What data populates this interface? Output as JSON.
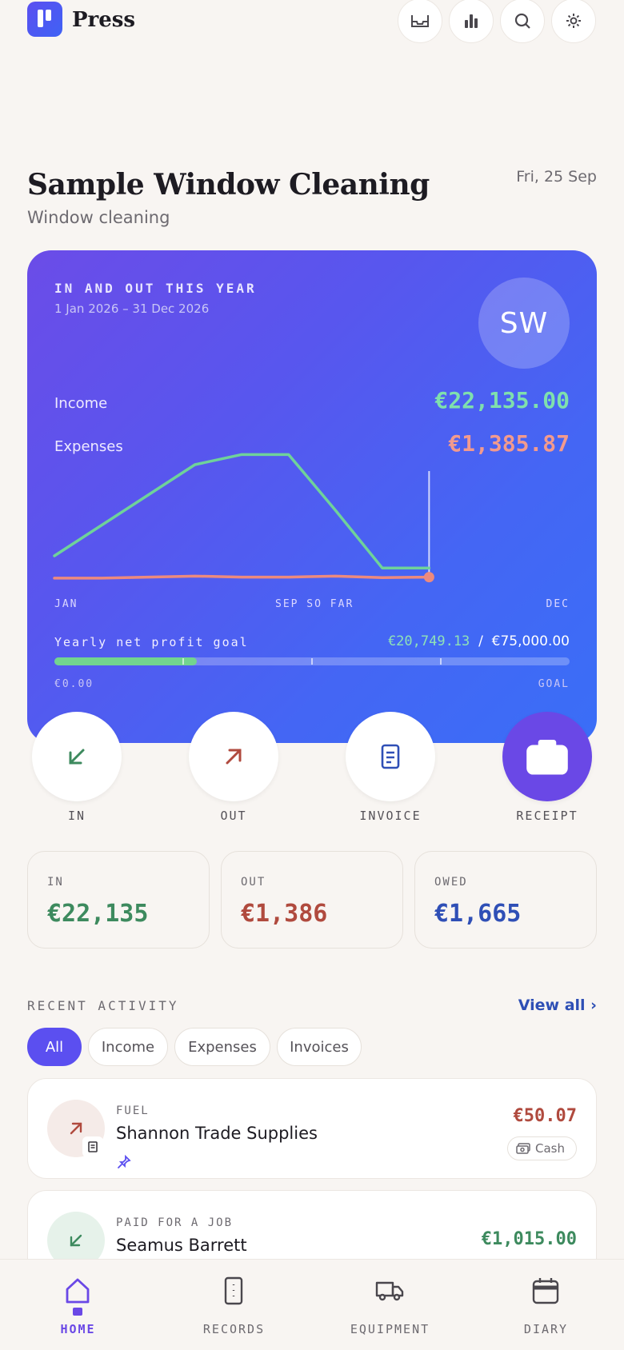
{
  "app": {
    "brand": "Press"
  },
  "header": {
    "icons": [
      "inbox-icon",
      "bar-chart-icon",
      "search-icon",
      "settings-icon"
    ]
  },
  "business": {
    "name": "Sample Window Cleaning",
    "trade": "Window cleaning",
    "date": "Fri, 25 Sep",
    "initials": "SW"
  },
  "summary": {
    "label": "IN AND OUT THIS YEAR",
    "range": "1 Jan 2026 – 31 Dec 2026",
    "income_label": "Income",
    "income_value": "€22,135.00",
    "expenses_label": "Expenses",
    "expenses_value": "€1,385.87",
    "axis_start": "JAN",
    "axis_mid": "SEP SO FAR",
    "axis_end": "DEC",
    "goal_label": "Yearly net profit goal",
    "goal_current": "€20,749.13",
    "goal_sep": "/",
    "goal_target": "€75,000.00",
    "goal_progress": 0.277,
    "goal_start": "€0.00",
    "goal_end": "GOAL"
  },
  "chart_data": {
    "type": "line",
    "x": [
      1,
      2,
      3,
      4,
      5,
      6,
      7,
      8,
      9
    ],
    "series": [
      {
        "values": [
          3000,
          6000,
          9000,
          12000,
          13000,
          13000,
          7500,
          1800,
          1800
        ],
        "color": "#6fd29a"
      },
      {
        "values": [
          800,
          800,
          900,
          1000,
          900,
          900,
          1000,
          850,
          900
        ],
        "color": "#ec8a7e"
      }
    ],
    "xlim": [
      1,
      12
    ],
    "ylim": [
      0,
      15000
    ],
    "current_month": 9,
    "grid": false
  },
  "actions": [
    {
      "label": "IN",
      "icon": "arrow-down-left-icon"
    },
    {
      "label": "OUT",
      "icon": "arrow-up-right-icon"
    },
    {
      "label": "INVOICE",
      "icon": "document-icon"
    },
    {
      "label": "RECEIPT",
      "icon": "camera-icon"
    }
  ],
  "stats": [
    {
      "label": "IN",
      "value": "€22,135",
      "color": "#3d8a5e"
    },
    {
      "label": "OUT",
      "value": "€1,386",
      "color": "#b04a3e"
    },
    {
      "label": "OWED",
      "value": "€1,665",
      "color": "#2f4fb6"
    }
  ],
  "activity": {
    "title": "RECENT ACTIVITY",
    "view_all": "View all ›",
    "filters": [
      "All",
      "Income",
      "Expenses",
      "Invoices"
    ],
    "active_filter": "All",
    "items": [
      {
        "category": "FUEL",
        "name": "Shannon Trade Supplies",
        "amount": "€50.07",
        "payment": "Cash",
        "type": "out"
      },
      {
        "category": "PAID FOR A JOB",
        "name": "Seamus Barrett",
        "amount": "€1,015.00",
        "payment": "",
        "type": "in"
      }
    ]
  },
  "nav": [
    {
      "label": "HOME",
      "icon": "home-icon",
      "active": true
    },
    {
      "label": "RECORDS",
      "icon": "records-icon",
      "active": false
    },
    {
      "label": "EQUIPMENT",
      "icon": "truck-icon",
      "active": false
    },
    {
      "label": "DIARY",
      "icon": "calendar-icon",
      "active": false
    }
  ],
  "colors": {
    "accent": "#5b4ff0",
    "income": "#3d8a5e",
    "expense": "#b04a3e",
    "owed": "#2f4fb6"
  }
}
